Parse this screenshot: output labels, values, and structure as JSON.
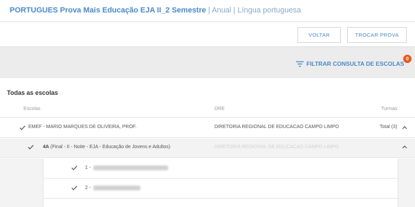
{
  "header": {
    "title_bold": "PORTUGUES Prova Mais Educação EJA II_2 Semestre",
    "title_rest": " | Anual | Língua portuguesa"
  },
  "actions": {
    "voltar": "VOLTAR",
    "trocar": "TROCAR PROVA"
  },
  "filter": {
    "label": "FILTRAR CONSULTA DE ESCOLAS",
    "badge": "0",
    "icon": "filter-lines-icon"
  },
  "schools_panel": {
    "title": "Todas as escolas",
    "columns": [
      "Escolas",
      "DRE",
      "Turmas"
    ],
    "school_row": {
      "name": "EMEF - MARIO MARQUES DE OLIVEIRA, PROF.",
      "dre": "DIRETORIA REGIONAL DE EDUCACAO CAMPO LIMPO",
      "turmas": "Total (3)"
    },
    "turma_row": {
      "code": "4A",
      "desc": " (Final - II - Noite - EJA - Educação de Jovens e Adultos)",
      "dre": "DIRETORIA REGIONAL DE EDUCACAO CAMPO LIMPO"
    },
    "students": [
      {
        "num": "1 -"
      },
      {
        "num": "2 -"
      }
    ]
  },
  "colors": {
    "accent": "#4a89c8",
    "badge": "#e85a1e",
    "background": "#ececec"
  }
}
